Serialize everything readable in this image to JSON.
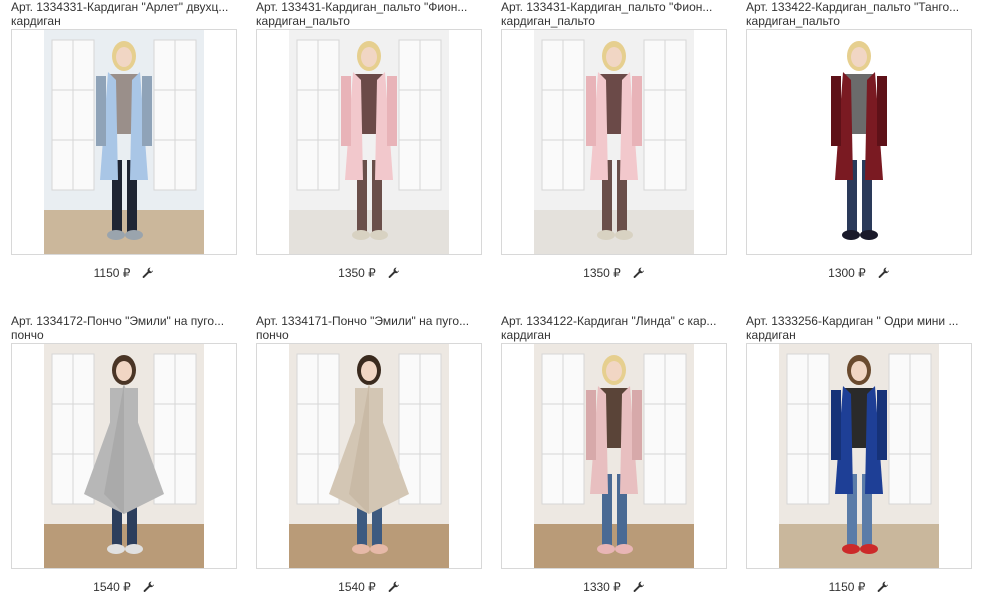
{
  "products": [
    {
      "title": "Арт. 1334331-Кардиган \"Арлет\" двухц...",
      "category": "кардиган",
      "price": "1150 ₽",
      "room": "#e9eef2",
      "floor": "#cbb79b",
      "coat": "#a9c6e6",
      "coat2": "#8fa3b8",
      "top": "#9a8f8a",
      "legs": "#1f2533",
      "shoes": "#9aa4ad",
      "hair": "#e6cf8f"
    },
    {
      "title": "Арт. 133431-Кардиган_пальто \"Фион...",
      "category": "кардиган_пальто",
      "price": "1350 ₽",
      "room": "#f1f1f1",
      "floor": "#e4e1dc",
      "coat": "#f2c8cc",
      "coat2": "#e8b3b8",
      "top": "#6b4a48",
      "legs": "#6a4f4a",
      "shoes": "#d8d2c2",
      "hair": "#e6cf8f"
    },
    {
      "title": "Арт. 133431-Кардиган_пальто \"Фион...",
      "category": "кардиган_пальто",
      "price": "1350 ₽",
      "room": "#f1f1f1",
      "floor": "#e4e1dc",
      "coat": "#f2c8cc",
      "coat2": "#e8b3b8",
      "top": "#6b4a48",
      "legs": "#6a4f4a",
      "shoes": "#d8d2c2",
      "hair": "#e6cf8f"
    },
    {
      "title": "Арт. 133422-Кардиган_пальто \"Танго...",
      "category": "кардиган_пальто",
      "price": "1300 ₽",
      "room": "#ffffff",
      "floor": "#ffffff",
      "coat": "#7a1a22",
      "coat2": "#5e1118",
      "top": "#6b6b6b",
      "legs": "#2a3a5a",
      "shoes": "#1a1a2a",
      "hair": "#e6cf8f"
    },
    {
      "title": "Арт. 1334172-Пончо \"Эмили\" на пуго...",
      "category": "пончо",
      "price": "1540 ₽",
      "room": "#ede8e2",
      "floor": "#b99b78",
      "coat": "#b7b7b7",
      "coat2": "#9e9e9e",
      "top": "#b7b7b7",
      "legs": "#2c3e5c",
      "shoes": "#e0e0e0",
      "hair": "#4a3526"
    },
    {
      "title": "Арт. 1334171-Пончо \"Эмили\" на пуго...",
      "category": "пончо",
      "price": "1540 ₽",
      "room": "#ede8e2",
      "floor": "#b99b78",
      "coat": "#d3c6b4",
      "coat2": "#bfae98",
      "top": "#d3c6b4",
      "legs": "#3d5a80",
      "shoes": "#e6b9a8",
      "hair": "#3a2a1e"
    },
    {
      "title": "Арт. 1334122-Кардиган \"Линда\" с кар...",
      "category": "кардиган",
      "price": "1330 ₽",
      "room": "#ede8e2",
      "floor": "#b99b78",
      "coat": "#e8bfc0",
      "coat2": "#d7a9aa",
      "top": "#5a4438",
      "legs": "#4a6a94",
      "shoes": "#e8b5b5",
      "hair": "#e6cf8f"
    },
    {
      "title": "Арт. 1333256-Кардиган \" Одри мини ...",
      "category": "кардиган",
      "price": "1150 ₽",
      "room": "#ede8e2",
      "floor": "#c9b79c",
      "coat": "#1e3f96",
      "coat2": "#163278",
      "top": "#2a2a2a",
      "legs": "#5b7ca8",
      "shoes": "#cc2a2a",
      "hair": "#6a4a2e"
    }
  ]
}
